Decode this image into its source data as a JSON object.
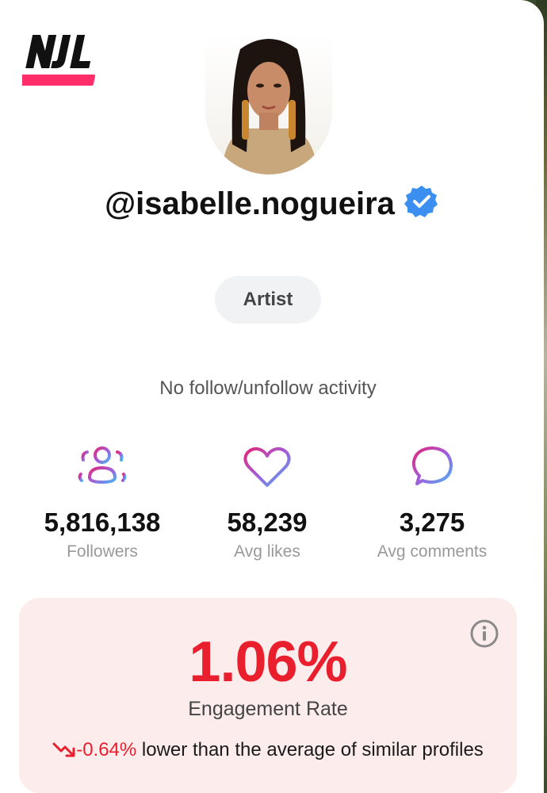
{
  "profile": {
    "username": "@isabelle.nogueira",
    "verified_icon": "verified-badge-icon",
    "category": "Artist",
    "activity": "No follow/unfollow activity"
  },
  "brand": {
    "logo_text": "NJL"
  },
  "stats": [
    {
      "icon": "followers-icon",
      "value": "5,816,138",
      "label": "Followers"
    },
    {
      "icon": "heart-icon",
      "value": "58,239",
      "label": "Avg likes"
    },
    {
      "icon": "comment-icon",
      "value": "3,275",
      "label": "Avg comments"
    }
  ],
  "engagement": {
    "rate": "1.06%",
    "label": "Engagement Rate",
    "delta": "-0.64%",
    "comparison": "lower than the average of similar profiles",
    "trend_icon": "trend-down-icon",
    "info_icon": "info-icon"
  },
  "colors": {
    "accent_red": "#ea1f2e",
    "engagement_bg": "#fdecec",
    "verified_blue": "#3b8ff0",
    "icon_gradient_start": "#e0297a",
    "icon_gradient_end": "#4ab3f4"
  }
}
